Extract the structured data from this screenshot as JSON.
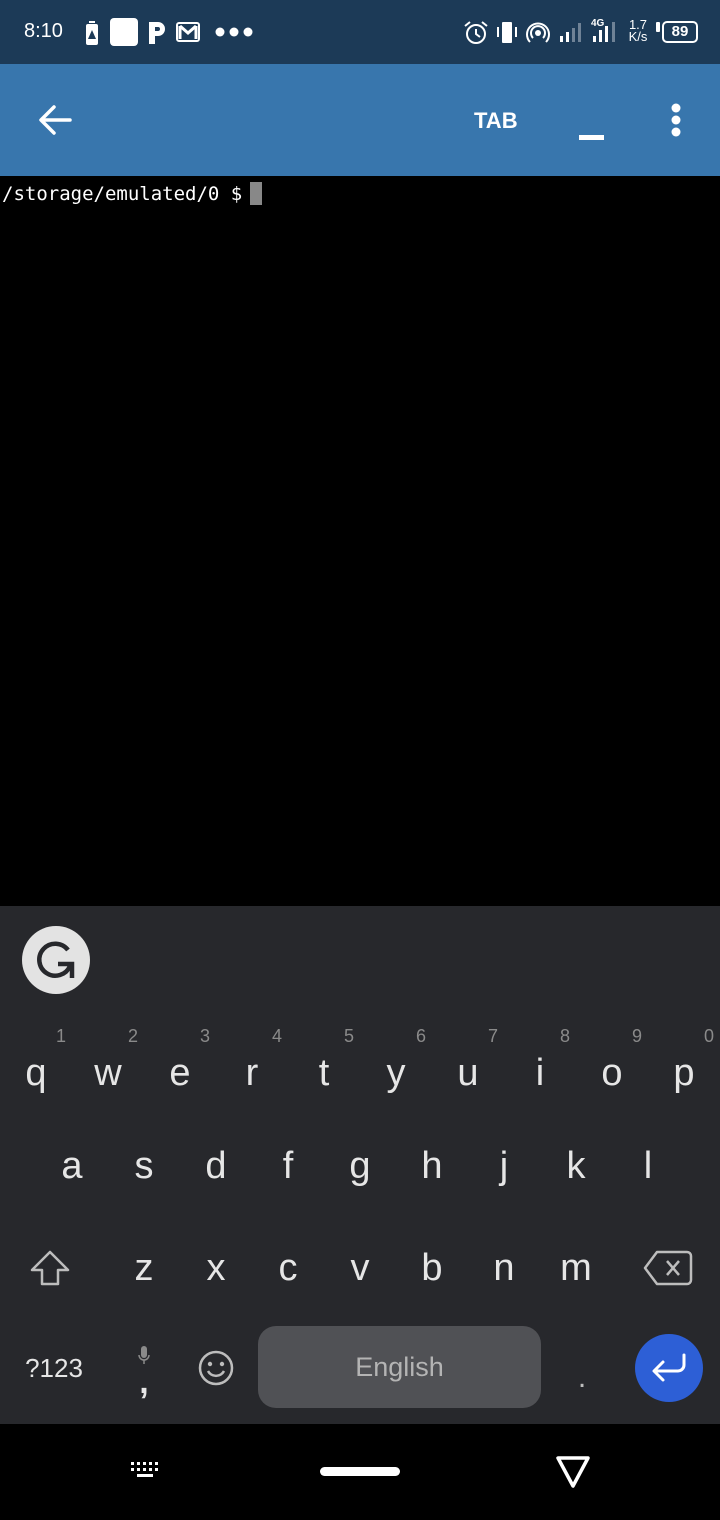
{
  "status_bar": {
    "time": "8:10",
    "left_icons": [
      "battery-alert-icon",
      "app-square-icon",
      "p-app-icon",
      "gmail-icon",
      "more-dots-icon"
    ],
    "right_icons": [
      "alarm-icon",
      "vibrate-icon",
      "hotspot-icon",
      "signal-icon",
      "signal-4g-icon"
    ],
    "network_type": "4G",
    "speed_value": "1.7",
    "speed_unit": "K/s",
    "battery": "89"
  },
  "app_bar": {
    "back_icon": "arrow-left-icon",
    "tab_label": "TAB",
    "underscore_label": "_",
    "more_icon": "more-vertical-icon",
    "colors": {
      "background": "#3876ad"
    }
  },
  "terminal": {
    "prompt": "/storage/emulated/0 $",
    "cursor": "block"
  },
  "keyboard": {
    "toolbar_icon": "grammarly-icon",
    "row1": [
      {
        "key": "q",
        "hint": "1"
      },
      {
        "key": "w",
        "hint": "2"
      },
      {
        "key": "e",
        "hint": "3"
      },
      {
        "key": "r",
        "hint": "4"
      },
      {
        "key": "t",
        "hint": "5"
      },
      {
        "key": "y",
        "hint": "6"
      },
      {
        "key": "u",
        "hint": "7"
      },
      {
        "key": "i",
        "hint": "8"
      },
      {
        "key": "o",
        "hint": "9"
      },
      {
        "key": "p",
        "hint": "0"
      }
    ],
    "row2": [
      "a",
      "s",
      "d",
      "f",
      "g",
      "h",
      "j",
      "k",
      "l"
    ],
    "row3": [
      "z",
      "x",
      "c",
      "v",
      "b",
      "n",
      "m"
    ],
    "symbols_label": "?123",
    "comma_label": ",",
    "space_label": "English",
    "period_label": ".",
    "colors": {
      "background": "#27282c",
      "enter": "#2d5fd6",
      "space": "#505155"
    }
  },
  "nav_bar": {
    "icons": [
      "keyboard-switch-icon",
      "home-pill-icon",
      "back-triangle-icon"
    ]
  }
}
